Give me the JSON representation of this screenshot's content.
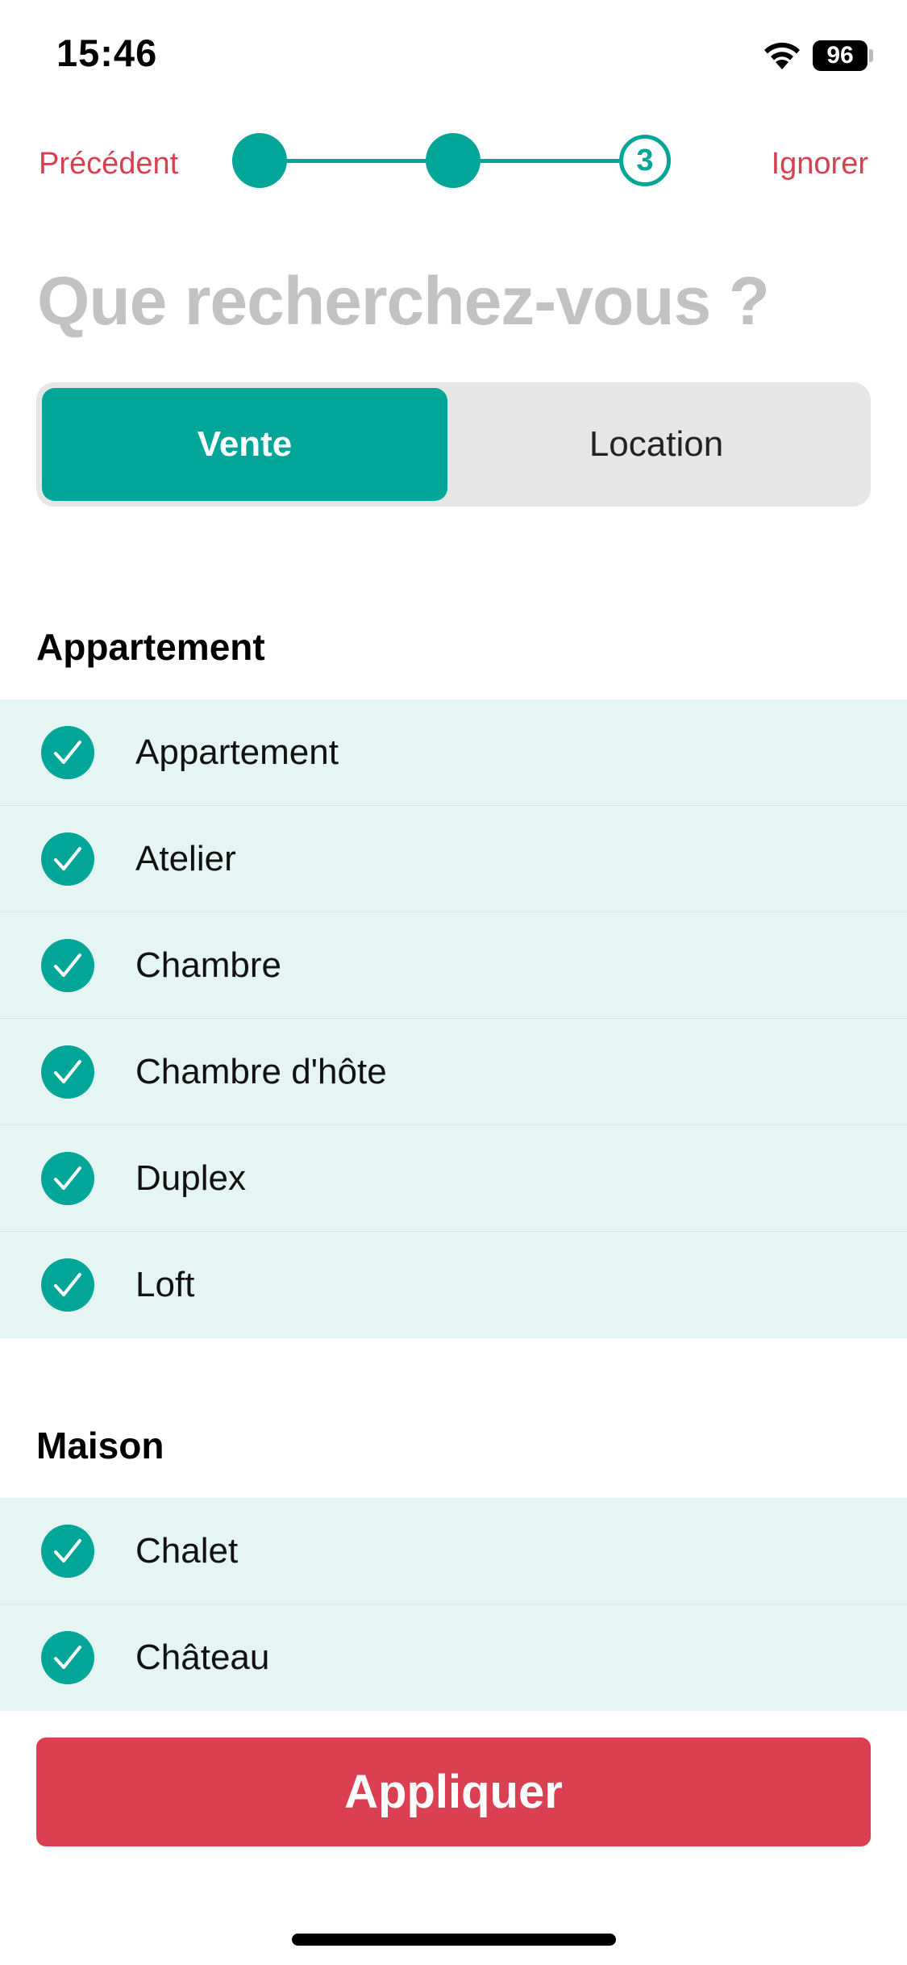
{
  "status_bar": {
    "time": "15:46",
    "battery": "96"
  },
  "nav": {
    "previous_label": "Précédent",
    "skip_label": "Ignorer",
    "current_step": "3"
  },
  "title": "Que recherchez-vous ?",
  "segmented": {
    "options": [
      "Vente",
      "Location"
    ],
    "selected": "Vente"
  },
  "sections": [
    {
      "title": "Appartement",
      "items": [
        {
          "label": "Appartement",
          "checked": true
        },
        {
          "label": "Atelier",
          "checked": true
        },
        {
          "label": "Chambre",
          "checked": true
        },
        {
          "label": "Chambre d'hôte",
          "checked": true
        },
        {
          "label": "Duplex",
          "checked": true
        },
        {
          "label": "Loft",
          "checked": true
        }
      ]
    },
    {
      "title": "Maison",
      "items": [
        {
          "label": "Chalet",
          "checked": true
        },
        {
          "label": "Château",
          "checked": true
        }
      ]
    }
  ],
  "apply_label": "Appliquer",
  "colors": {
    "accent": "#01a699",
    "danger": "#db4052",
    "list_bg": "#e5f5f4",
    "title_gray": "#c2c2c2"
  }
}
